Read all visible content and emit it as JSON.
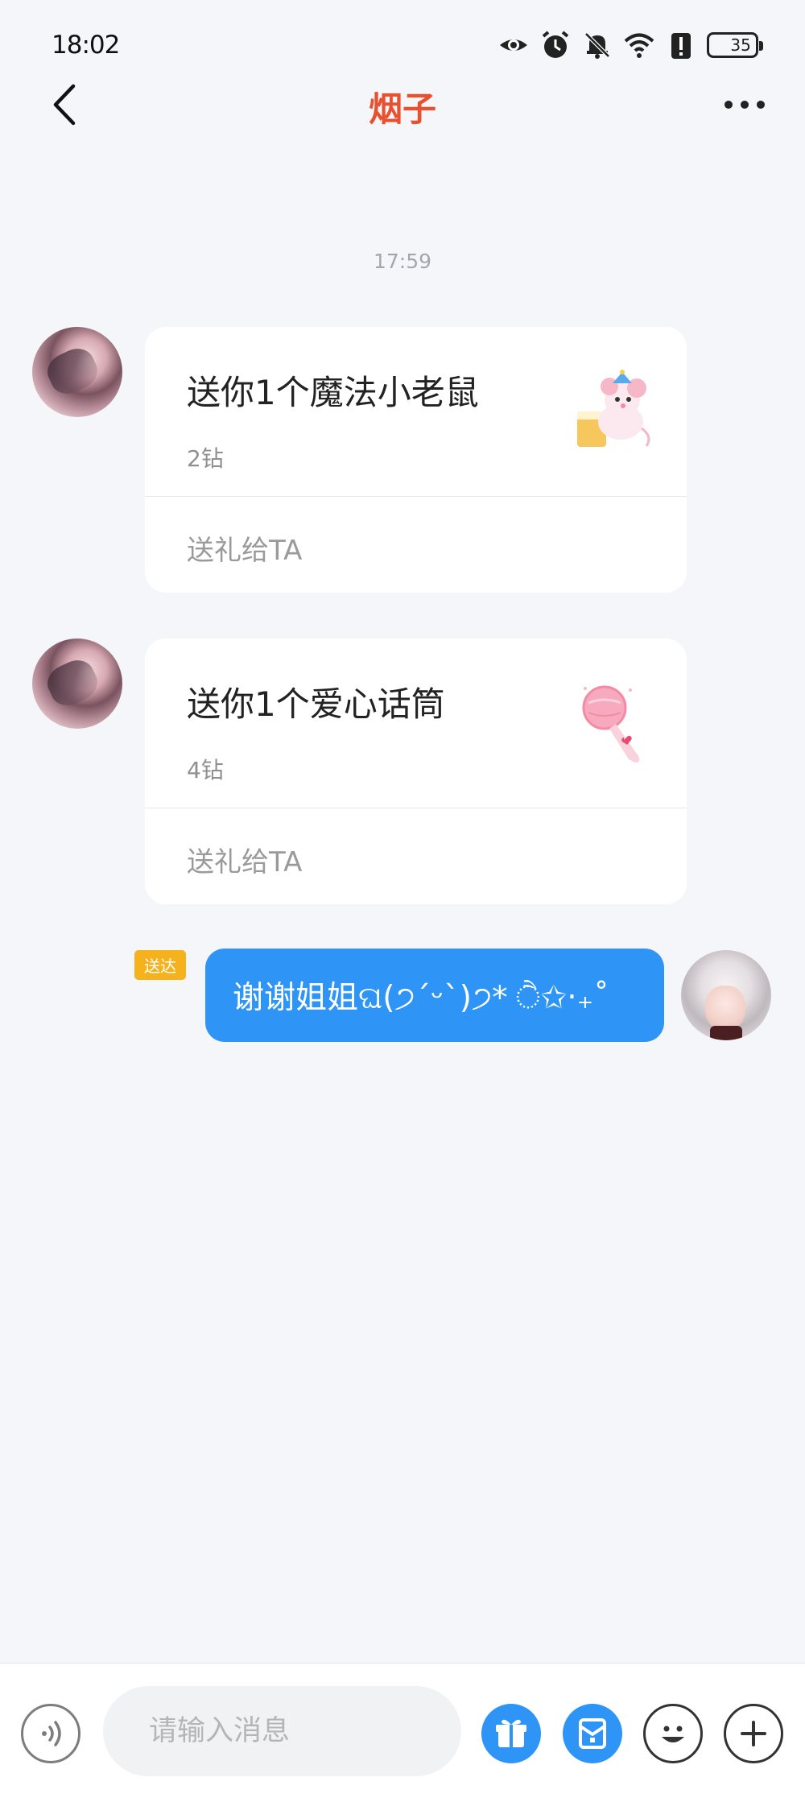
{
  "status_bar": {
    "time": "18:02",
    "battery": "35",
    "battery_level": 0.35,
    "icons": [
      "eye-icon",
      "alarm-icon",
      "bell-off-icon",
      "wifi-icon",
      "alert-icon",
      "battery-icon"
    ]
  },
  "header": {
    "title": "烟子",
    "back_icon": "chevron-left-icon",
    "more_icon": "more-dots-icon"
  },
  "chat": {
    "timestamp": "17:59",
    "gifts": [
      {
        "title": "送你1个魔法小老鼠",
        "cost": "2钻",
        "action": "送礼给TA",
        "image_icon": "magic-mouse-icon"
      },
      {
        "title": "送你1个爱心话筒",
        "cost": "4钻",
        "action": "送礼给TA",
        "image_icon": "heart-microphone-icon"
      }
    ],
    "sent_message": {
      "badge": "送达",
      "text": "谢谢姐姐ଘ(੭ˊᵕˋ)੭* ੈ✩‧₊˚"
    }
  },
  "input_bar": {
    "placeholder": "请输入消息",
    "value": "",
    "buttons": [
      "voice-icon",
      "gift-icon",
      "red-packet-icon",
      "emoji-icon",
      "plus-icon"
    ]
  },
  "colors": {
    "accent": "#2e95f6",
    "title": "#e8502f",
    "badge": "#f6b21c",
    "background": "#f4f6f9"
  }
}
